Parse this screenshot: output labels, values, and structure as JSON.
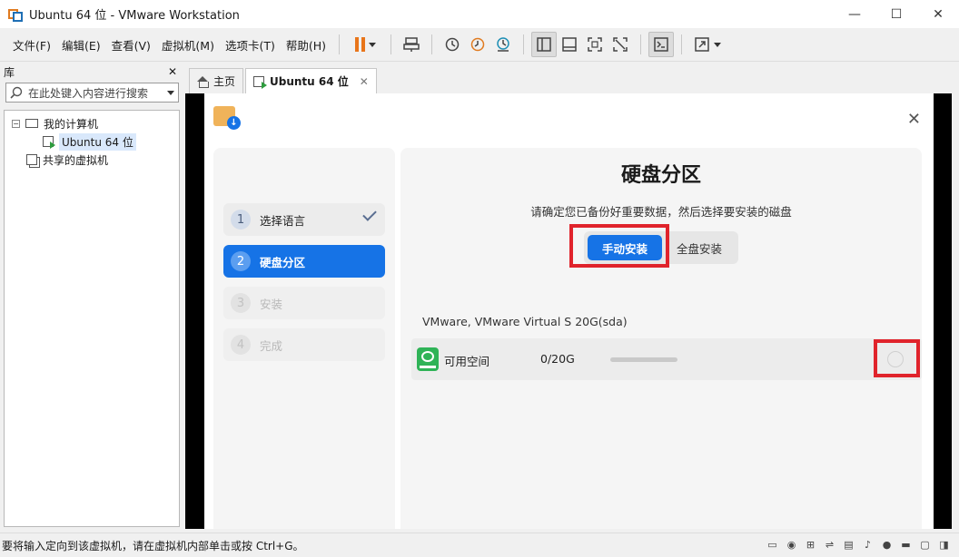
{
  "window": {
    "title": "Ubuntu 64 位 - VMware Workstation",
    "minimize": "—",
    "maximize": "☐",
    "close": "✕"
  },
  "menu": {
    "items": [
      "文件(F)",
      "编辑(E)",
      "查看(V)",
      "虚拟机(M)",
      "选项卡(T)",
      "帮助(H)"
    ]
  },
  "library": {
    "title": "库",
    "close": "✕",
    "search_placeholder": "在此处键入内容进行搜索",
    "tree": {
      "my_computer": "我的计算机",
      "vm": "Ubuntu 64 位",
      "shared": "共享的虚拟机",
      "toggle": "−"
    }
  },
  "tabs": [
    {
      "label": "主页"
    },
    {
      "label": "Ubuntu 64 位",
      "close": "✕"
    }
  ],
  "installer": {
    "close": "✕",
    "logo_arrow": "↓",
    "steps": [
      {
        "num": "1",
        "label": "选择语言",
        "state": "done"
      },
      {
        "num": "2",
        "label": "硬盘分区",
        "state": "current"
      },
      {
        "num": "3",
        "label": "安装",
        "state": "pending"
      },
      {
        "num": "4",
        "label": "完成",
        "state": "pending"
      }
    ],
    "title": "硬盘分区",
    "subtitle": "请确定您已备份好重要数据，然后选择要安装的磁盘",
    "mode_manual": "手动安装",
    "mode_full": "全盘安装",
    "disk_name": "VMware, VMware Virtual S 20G(sda)",
    "disk_label": "可用空间",
    "disk_size": "0/20G",
    "disk_usage_fraction": 0
  },
  "status": {
    "text": "要将输入定向到该虚拟机，请在虚拟机内部单击或按 Ctrl+G。"
  },
  "colors": {
    "accent": "#1673e6",
    "highlight": "#e0232b",
    "pause": "#e8751a"
  }
}
